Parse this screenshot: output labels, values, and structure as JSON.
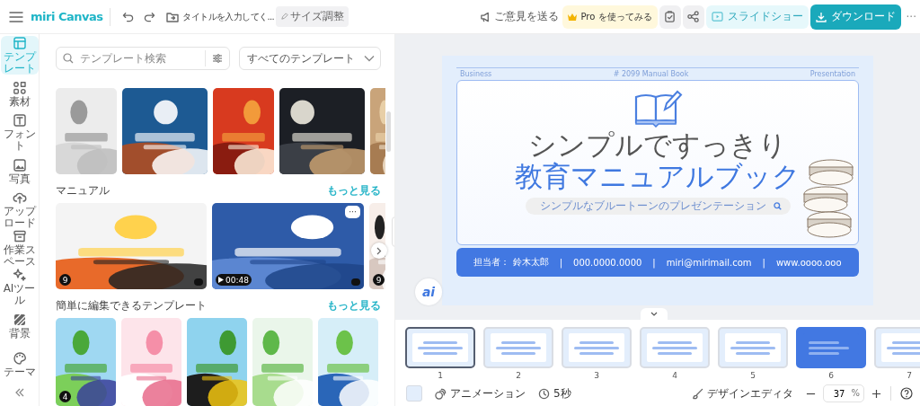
{
  "top_bar": {
    "app_name": "miri Canvas",
    "document_title": "タイトルを入力してく...",
    "resize_button": "サイズ調整",
    "feedback_button": "ご意見を送る",
    "pro_button": "Pro を使ってみる",
    "slideshow_button": "スライドショー",
    "download_button": "ダウンロード",
    "more_button": "···"
  },
  "sidebar": {
    "items": [
      {
        "label": "テンプレート",
        "selected": true
      },
      {
        "label": "素材",
        "selected": false
      },
      {
        "label": "フォント",
        "selected": false
      },
      {
        "label": "写真",
        "selected": false
      },
      {
        "label": "アップロード",
        "selected": false
      },
      {
        "label": "作業スペース",
        "selected": false
      },
      {
        "label": "AIツール",
        "selected": false
      },
      {
        "label": "背景",
        "selected": false
      },
      {
        "label": "テーマ",
        "selected": false
      }
    ]
  },
  "template_panel": {
    "search": {
      "placeholder": "テンプレート検索"
    },
    "category_dropdown": "すべてのテンプレート",
    "featured": [
      {
        "kind": "picture"
      },
      {
        "kind": "picture"
      },
      {
        "kind": "picture"
      },
      {
        "kind": "picture"
      },
      {
        "kind": "picture"
      }
    ],
    "sections": [
      {
        "title": "マニュアル",
        "more_link": "もっと見る",
        "cards": [
          {
            "kind": "picture",
            "page_count": "9",
            "premium": true
          },
          {
            "kind": "picture",
            "duration": "00:48",
            "premium": true,
            "menu_button": "···"
          },
          {
            "kind": "picture",
            "page_count": "9",
            "premium": false
          }
        ]
      },
      {
        "title": "簡単に編集できるテンプレート",
        "more_link": "もっと見る",
        "cards": [
          {
            "kind": "picture",
            "page_count": "4",
            "premium": false
          },
          {
            "kind": "picture",
            "premium": false
          },
          {
            "kind": "picture",
            "premium": false
          },
          {
            "kind": "picture",
            "premium": false
          },
          {
            "kind": "picture",
            "premium": false
          }
        ]
      }
    ]
  },
  "slide": {
    "header_left": "Business",
    "header_center": "# 2099 Manual Book",
    "header_right": "Presentation",
    "title_line_1": "シンプルですっきり",
    "title_line_2": "教育マニュアルブック",
    "search_pill": "シンプルなブルートーンのプレゼンテーション",
    "footer": [
      "担当者： 鈴木太郎",
      "|",
      "000.0000.0000",
      "|",
      "miri@mirimail.com",
      "|",
      "www.oooo.ooo"
    ]
  },
  "ai_button": "ai",
  "slide_strip": {
    "slides": [
      {
        "number": "1",
        "kind": "light",
        "selected": true
      },
      {
        "number": "2",
        "kind": "light",
        "selected": false
      },
      {
        "number": "3",
        "kind": "light",
        "selected": false
      },
      {
        "number": "4",
        "kind": "light",
        "selected": false
      },
      {
        "number": "5",
        "kind": "light",
        "selected": false
      },
      {
        "number": "6",
        "kind": "dark",
        "selected": false
      },
      {
        "number": "7",
        "kind": "light",
        "selected": false
      }
    ]
  },
  "bottom_bar": {
    "animation_button": "アニメーション",
    "duration_button": "5秒",
    "design_editor_button": "デザインエディタ",
    "zoom": {
      "value": "37",
      "unit": "%"
    }
  }
}
